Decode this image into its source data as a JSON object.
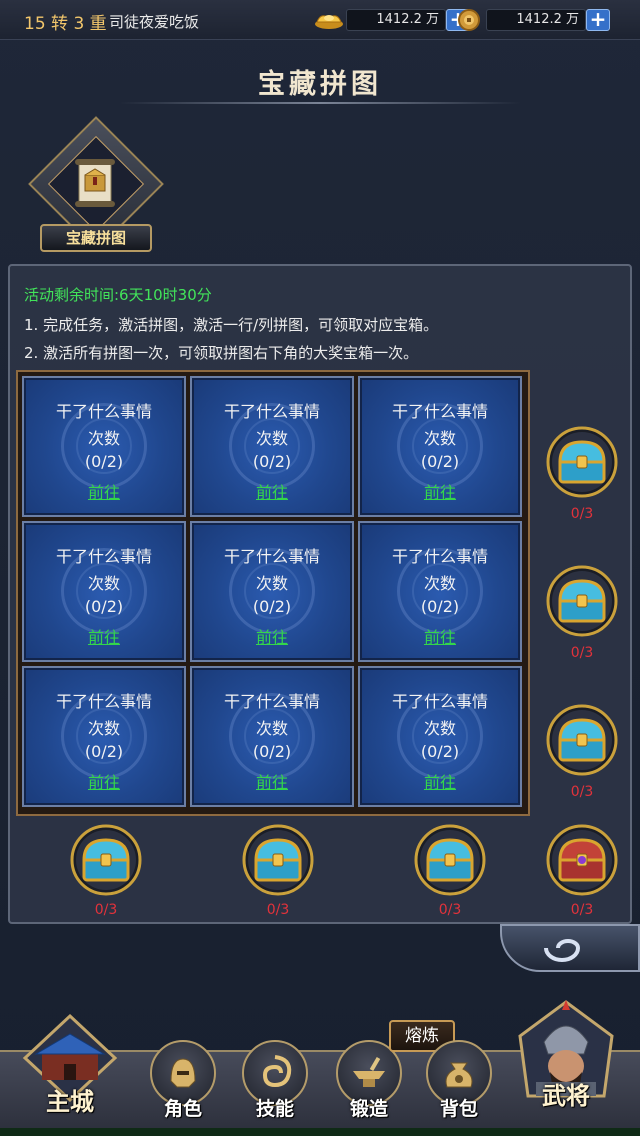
{
  "topbar": {
    "level": "15 转 3 重",
    "player_name": "司徒夜爱吃饭",
    "gold": "1412.2 万",
    "coin": "1412.2 万",
    "add_symbol": "+"
  },
  "page_title": "宝藏拼图",
  "activity_badge_label": "宝藏拼图",
  "panel": {
    "timer": "活动剩余时间:6天10时30分",
    "rules": [
      "1. 完成任务，激活拼图，激活一行/列拼图，可领取对应宝箱。",
      "2. 激活所有拼图一次，可领取拼图右下角的大奖宝箱一次。"
    ]
  },
  "tasks": [
    {
      "name": "干了什么事情",
      "count_label": "次数",
      "progress": "(0/2)",
      "action": "前往"
    },
    {
      "name": "干了什么事情",
      "count_label": "次数",
      "progress": "(0/2)",
      "action": "前往"
    },
    {
      "name": "干了什么事情",
      "count_label": "次数",
      "progress": "(0/2)",
      "action": "前往"
    },
    {
      "name": "干了什么事情",
      "count_label": "次数",
      "progress": "(0/2)",
      "action": "前往"
    },
    {
      "name": "干了什么事情",
      "count_label": "次数",
      "progress": "(0/2)",
      "action": "前往"
    },
    {
      "name": "干了什么事情",
      "count_label": "次数",
      "progress": "(0/2)",
      "action": "前往"
    },
    {
      "name": "干了什么事情",
      "count_label": "次数",
      "progress": "(0/2)",
      "action": "前往"
    },
    {
      "name": "干了什么事情",
      "count_label": "次数",
      "progress": "(0/2)",
      "action": "前往"
    },
    {
      "name": "干了什么事情",
      "count_label": "次数",
      "progress": "(0/2)",
      "action": "前往"
    }
  ],
  "row_chests": [
    "0/3",
    "0/3",
    "0/3"
  ],
  "column_chests": [
    "0/3",
    "0/3",
    "0/3"
  ],
  "grand_chest": "0/3",
  "colors": {
    "timer": "#42e45a",
    "go_link": "#34d64b",
    "chest_count": "#e2323b",
    "tile_blue": "#20478e"
  },
  "nav": {
    "city": "主城",
    "role": "角色",
    "skill": "技能",
    "forge": "锻造",
    "bag": "背包",
    "generals": "武将",
    "forge_tag": "熔炼"
  }
}
